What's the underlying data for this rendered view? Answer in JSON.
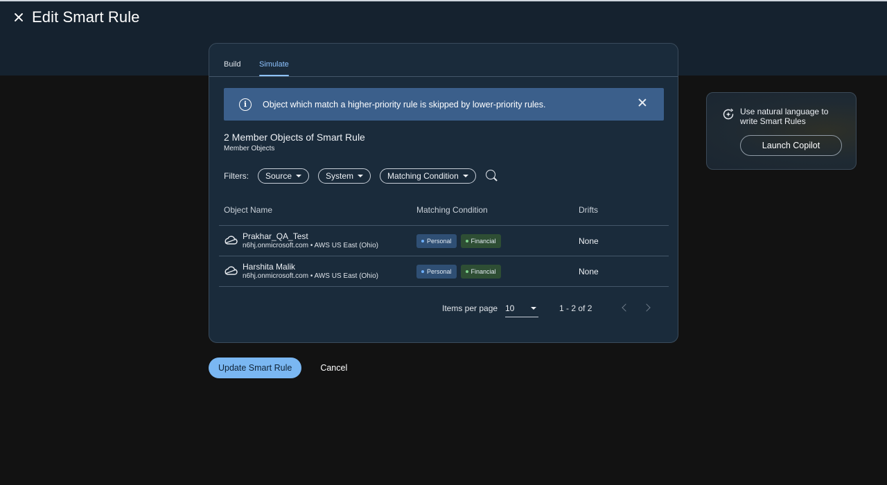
{
  "header": {
    "title": "Edit Smart Rule"
  },
  "tabs": [
    {
      "label": "Build",
      "active": false
    },
    {
      "label": "Simulate",
      "active": true
    }
  ],
  "banner": {
    "text": "Object which match a higher-priority rule is skipped by lower-priority rules.",
    "color": "#3b5f8b"
  },
  "section": {
    "title": "2 Member Objects of Smart Rule",
    "subtitle": "Member Objects"
  },
  "filters": {
    "label": "Filters:",
    "chips": [
      "Source",
      "System",
      "Matching Condition"
    ]
  },
  "table": {
    "columns": [
      "Object Name",
      "Matching Condition",
      "Drifts"
    ],
    "rows": [
      {
        "name": "Prakhar_QA_Test",
        "meta": "n6hj.onmicrosoft.com • AWS US East (Ohio)",
        "tags": [
          "Personal",
          "Financial"
        ],
        "drifts": "None",
        "icon": "cloud-icon"
      },
      {
        "name": "Harshita Malik",
        "meta": "n6hj.onmicrosoft.com • AWS US East (Ohio)",
        "tags": [
          "Personal",
          "Financial"
        ],
        "drifts": "None",
        "icon": "cloud-icon"
      }
    ]
  },
  "pagination": {
    "items_per_page_label": "Items per page",
    "items_per_page": "10",
    "range": "1 - 2 of 2"
  },
  "actions": {
    "primary": "Update Smart Rule",
    "cancel": "Cancel",
    "primary_color": "#7ab7f2"
  },
  "copilot": {
    "text": "Use natural language to write Smart Rules",
    "button": "Launch Copilot"
  },
  "colors": {
    "accent": "#8ec3ff",
    "card_bg": "#1a2b3b",
    "personal_tag": "#2f4f74",
    "financial_tag": "#2e4e34"
  }
}
